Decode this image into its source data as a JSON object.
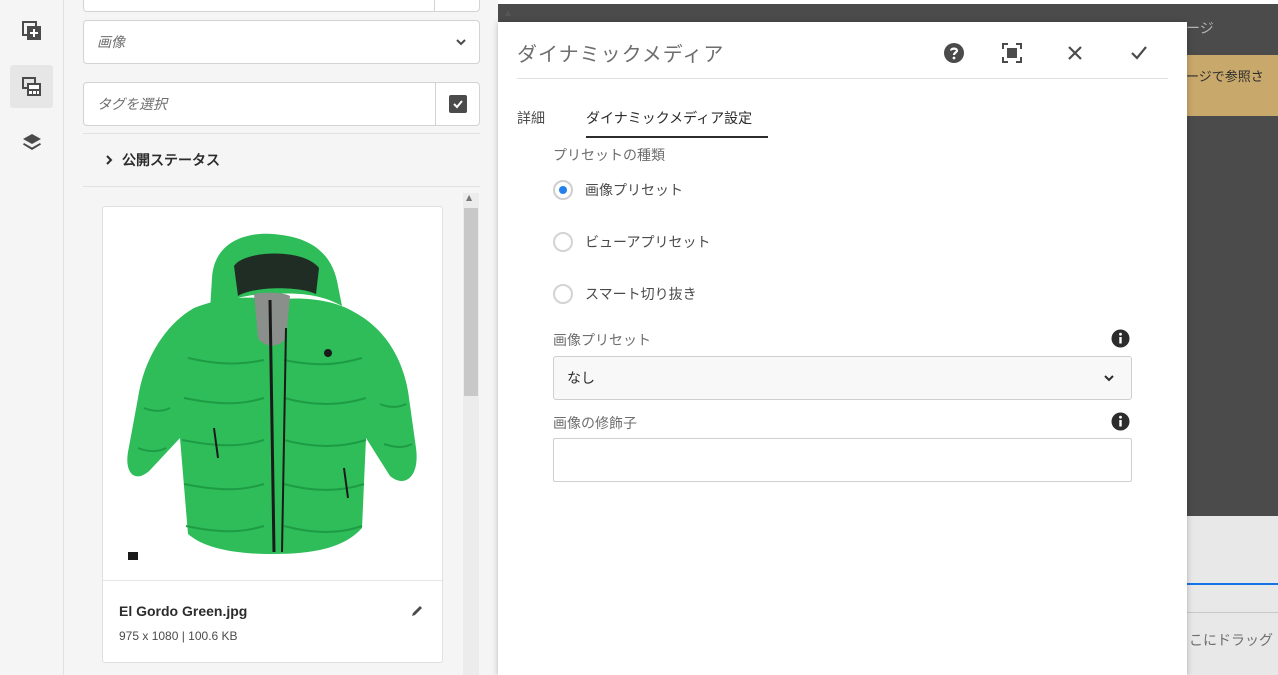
{
  "rail": {
    "items": [
      {
        "icon": "add-component-icon"
      },
      {
        "icon": "assets-icon"
      },
      {
        "icon": "layers-icon"
      }
    ]
  },
  "assets_panel": {
    "type_select": {
      "placeholder": "画像"
    },
    "tag_field": {
      "placeholder": "タグを選択"
    },
    "publish_status_label": "公開ステータス",
    "asset_card": {
      "name": "El Gordo Green.jpg",
      "info": "975 x 1080 | 100.6 KB",
      "image_color": "#2ebd59"
    }
  },
  "background_page": {
    "header_text": "ージ",
    "banner_text": "ージで参照さ",
    "drag_text": "こにドラッグ",
    "banner_color": "#c8a86b"
  },
  "dialog": {
    "title": "ダイナミックメディア",
    "actions": [
      {
        "icon": "help-icon"
      },
      {
        "icon": "fullscreen-icon"
      },
      {
        "icon": "close-icon"
      },
      {
        "icon": "checkmark-icon"
      }
    ],
    "tabs": [
      {
        "label": "詳細",
        "active": false
      },
      {
        "label": "ダイナミックメディア設定",
        "active": true
      }
    ],
    "preset_type_label": "プリセットの種類",
    "preset_options": [
      {
        "label": "画像プリセット",
        "selected": true
      },
      {
        "label": "ビューアプリセット",
        "selected": false
      },
      {
        "label": "スマート切り抜き",
        "selected": false
      }
    ],
    "image_preset": {
      "label": "画像プリセット",
      "value": "なし"
    },
    "image_modifier": {
      "label": "画像の修飾子",
      "value": ""
    },
    "accent_color": "#2680eb"
  }
}
